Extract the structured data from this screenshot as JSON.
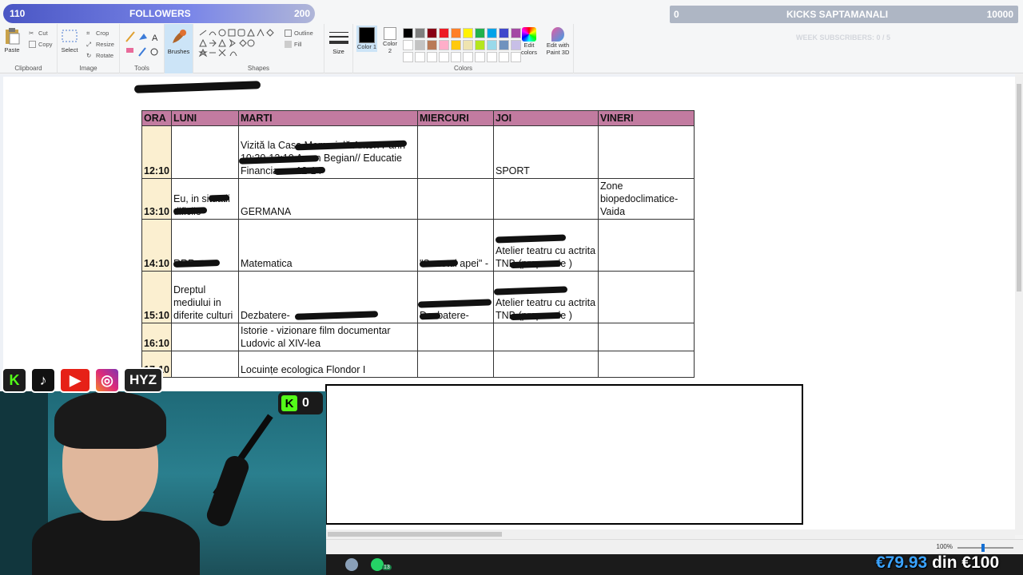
{
  "ribbon": {
    "clipboard": {
      "paste": "Paste",
      "cut": "Cut",
      "copy": "Copy",
      "label": "Clipboard"
    },
    "image": {
      "select": "Select",
      "crop": "Crop",
      "resize": "Resize",
      "rotate": "Rotate",
      "label": "Image"
    },
    "tools": {
      "label": "Tools"
    },
    "brushes": {
      "label": "Brushes"
    },
    "shapes": {
      "outline": "Outline",
      "fill": "Fill",
      "label": "Shapes"
    },
    "size": {
      "label": "Size"
    },
    "colors": {
      "color1": "Color 1",
      "color2": "Color 2",
      "edit_colors": "Edit colors",
      "edit_paint3d": "Edit with Paint 3D",
      "label": "Colors",
      "palette": [
        "#000000",
        "#7f7f7f",
        "#880015",
        "#ed1c24",
        "#ff7f27",
        "#fff200",
        "#22b14c",
        "#00a2e8",
        "#3f48cc",
        "#a349a4",
        "#ffffff",
        "#c3c3c3",
        "#b97a57",
        "#ffaec9",
        "#ffc90e",
        "#efe4b0",
        "#b5e61d",
        "#99d9ea",
        "#7092be",
        "#c8bfe7"
      ]
    }
  },
  "overlay": {
    "followers_current": "110",
    "followers_label": "FOLLOWERS",
    "followers_goal": "200",
    "kicks_current": "0",
    "kicks_label": "KICKS SAPTAMANALI",
    "kicks_goal": "10000",
    "week_subs": "WEEK SUBSCRIBERS: 0 / 5",
    "kick_count": "0",
    "social_handle": "HYZ",
    "money_current": "€79.93",
    "money_word": "din",
    "money_goal": "€100"
  },
  "schedule": {
    "headers": [
      "ORA",
      "LUNI",
      "MARTI",
      "MIERCURI",
      "JOI",
      "VINERI"
    ],
    "rows": [
      {
        "ora": "12:10",
        "luni": "",
        "marti": "Vizită la Casa Memorială Anton Pann 10:30-12:10 Awan Begian// Educatie Financiara - 12-14",
        "miercuri": "",
        "joi": "SPORT",
        "vineri": ""
      },
      {
        "ora": "13:10",
        "luni": "Eu, in situatii dificile-",
        "marti": "GERMANA",
        "miercuri": "",
        "joi": "",
        "vineri": "Zone biopedoclimatice-Vaida"
      },
      {
        "ora": "14:10",
        "luni": "RRR -",
        "marti": "Matematica",
        "miercuri": "\"Sunetul apei\" -",
        "joi": "Atelier teatru cu actrita TNB (propus de )",
        "vineri": ""
      },
      {
        "ora": "15:10",
        "luni": "Dreptul mediului in diferite culturi",
        "marti": "Dezbatere-",
        "miercuri": "Dezbatere-",
        "joi": "Atelier teatru cu actrita TNB (propus de )",
        "vineri": ""
      },
      {
        "ora": "16:10",
        "luni": "",
        "marti": "Istorie - vizionare film documentar Ludovic al XIV-lea",
        "miercuri": "",
        "joi": "",
        "vineri": ""
      },
      {
        "ora": "17:10",
        "luni": "",
        "marti": "Locuințe ecologica Flondor I",
        "miercuri": "",
        "joi": "",
        "vineri": ""
      }
    ]
  },
  "statusbar": {
    "zoom": "100%"
  },
  "taskbar": {
    "whatsapp_badge": "13"
  }
}
